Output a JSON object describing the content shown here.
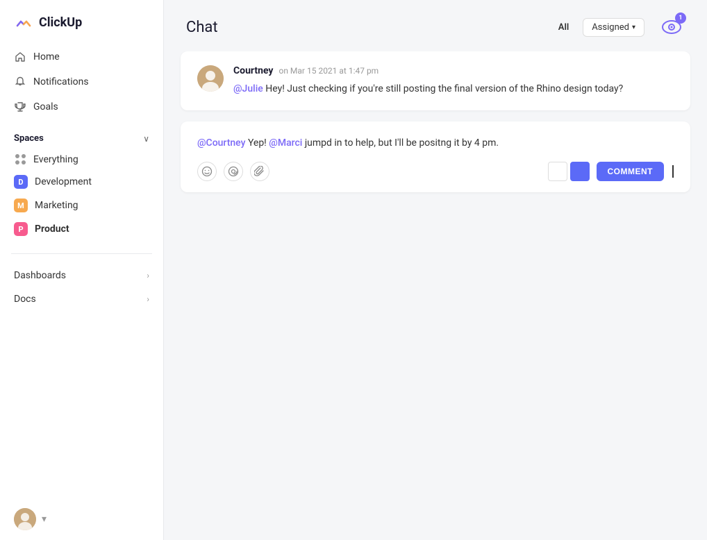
{
  "app": {
    "name": "ClickUp"
  },
  "sidebar": {
    "nav": [
      {
        "id": "home",
        "label": "Home",
        "icon": "home"
      },
      {
        "id": "notifications",
        "label": "Notifications",
        "icon": "bell"
      },
      {
        "id": "goals",
        "label": "Goals",
        "icon": "trophy"
      }
    ],
    "spaces_label": "Spaces",
    "spaces": [
      {
        "id": "everything",
        "label": "Everything",
        "type": "dots"
      },
      {
        "id": "development",
        "label": "Development",
        "badge": "D",
        "color": "#5b6af7"
      },
      {
        "id": "marketing",
        "label": "Marketing",
        "badge": "M",
        "color": "#f7a94f"
      },
      {
        "id": "product",
        "label": "Product",
        "badge": "P",
        "color": "#f75b8e",
        "bold": true
      }
    ],
    "bottom_nav": [
      {
        "id": "dashboards",
        "label": "Dashboards"
      },
      {
        "id": "docs",
        "label": "Docs"
      }
    ],
    "user_chevron": "▾"
  },
  "chat": {
    "title": "Chat",
    "filter_all": "All",
    "filter_assigned": "Assigned",
    "watch_count": "1",
    "messages": [
      {
        "id": "msg1",
        "author": "Courtney",
        "time": "on Mar 15 2021 at 1:47 pm",
        "mention": "@Julie",
        "text": "Hey! Just checking if you're still posting the final version of the Rhino design today?"
      }
    ],
    "reply": {
      "mention1": "@Courtney",
      "text1": " Yep! ",
      "mention2": "@Marci",
      "text2": " jumpd in to help, but I'll be positng it by 4 pm."
    },
    "toolbar": {
      "comment_label": "COMMENT"
    }
  }
}
